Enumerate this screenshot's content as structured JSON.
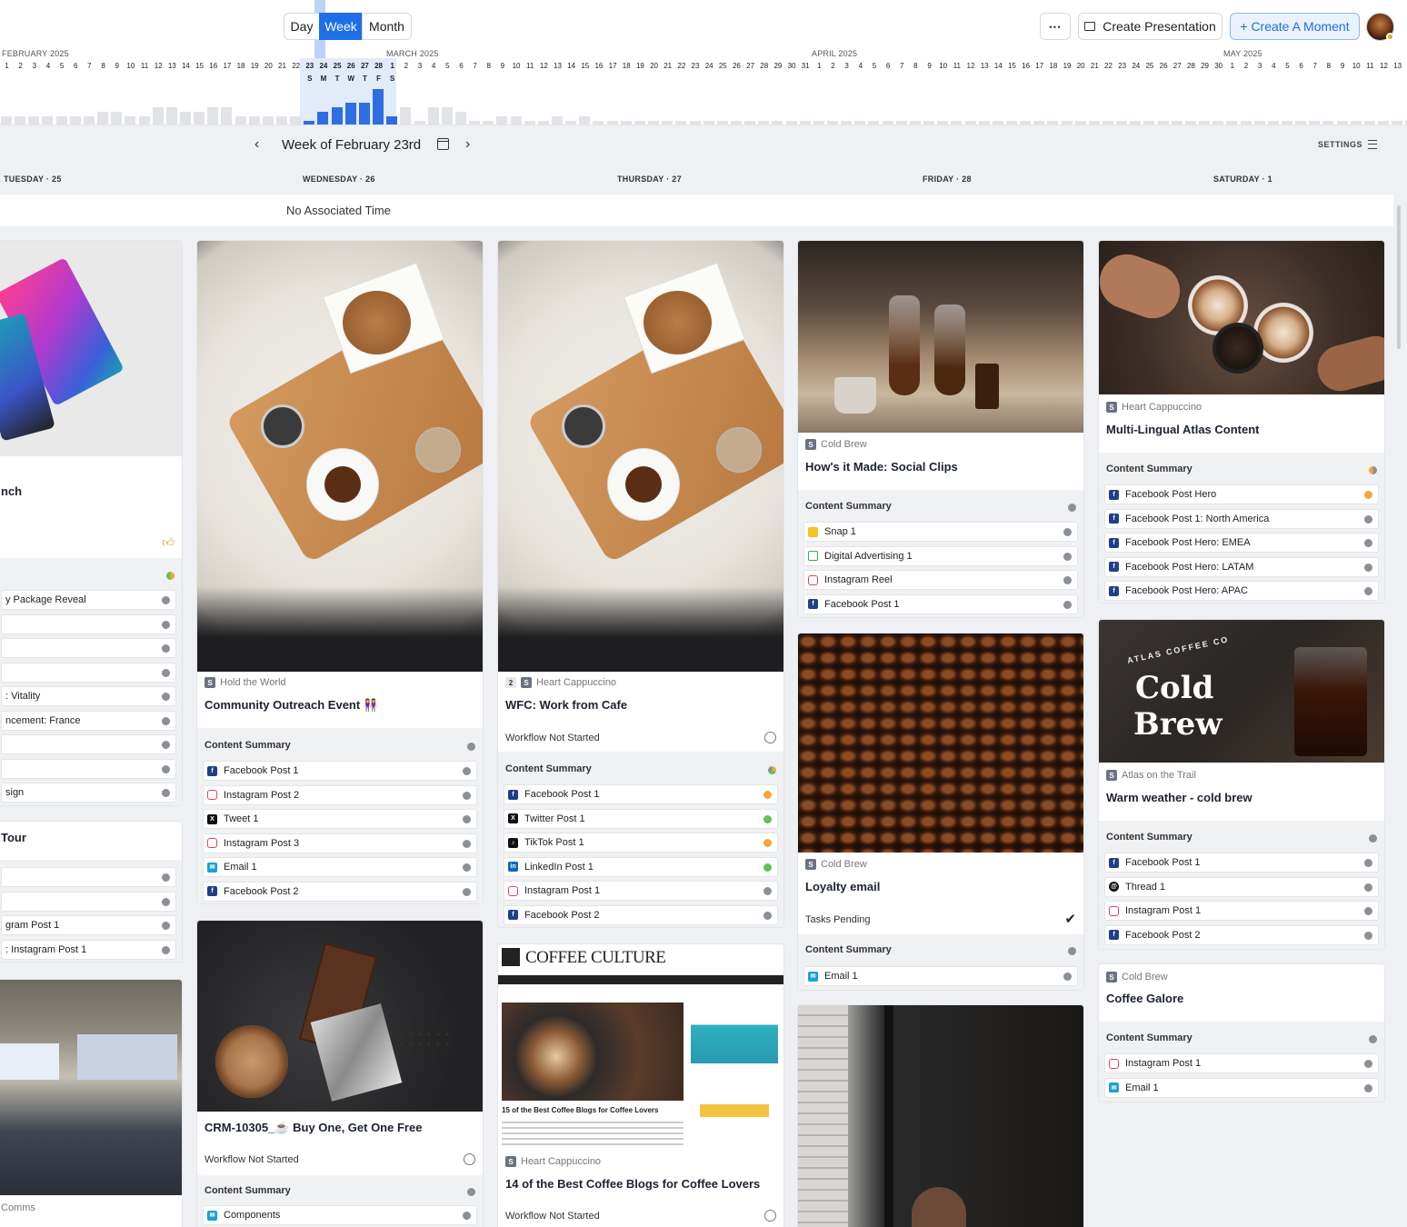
{
  "views": {
    "day": "Day",
    "week": "Week",
    "month": "Month"
  },
  "toolbar": {
    "more": "⋯",
    "present_label": "Create Presentation",
    "moment_label": "+ Create A Moment"
  },
  "icons": {
    "present": "presentation-icon",
    "moment": "plus-icon",
    "calendar": "calendar-icon",
    "settings": "sliders-icon",
    "prev": "chevron-left-icon",
    "next": "chevron-right-icon"
  },
  "timeline": {
    "months": [
      "FEBRUARY 2025",
      "MARCH 2025",
      "APRIL 2025",
      "MAY 2025"
    ],
    "days": [
      "1",
      "2",
      "3",
      "4",
      "5",
      "6",
      "7",
      "8",
      "9",
      "10",
      "11",
      "12",
      "13",
      "14",
      "15",
      "16",
      "17",
      "18",
      "19",
      "20",
      "21",
      "22",
      "23",
      "24",
      "25",
      "26",
      "27",
      "28",
      "1",
      "2",
      "3",
      "4",
      "5",
      "6",
      "7",
      "8",
      "9",
      "10",
      "11",
      "12",
      "13",
      "14",
      "15",
      "16",
      "17",
      "18",
      "19",
      "20",
      "21",
      "22",
      "23",
      "24",
      "25",
      "26",
      "27",
      "28",
      "29",
      "30",
      "31",
      "1",
      "2",
      "3",
      "4",
      "5",
      "6",
      "7",
      "8",
      "9",
      "10",
      "11",
      "12",
      "13",
      "14",
      "15",
      "16",
      "17",
      "18",
      "19",
      "20",
      "21",
      "22",
      "23",
      "24",
      "25",
      "26",
      "27",
      "28",
      "29",
      "30",
      "1",
      "2",
      "3",
      "4",
      "5",
      "6",
      "7",
      "8",
      "9",
      "10",
      "11",
      "12",
      "13",
      "14"
    ],
    "week_letters": [
      "S",
      "M",
      "T",
      "W",
      "T",
      "F",
      "S"
    ],
    "counts": [
      1,
      1,
      1,
      1,
      1,
      1,
      1,
      2,
      2,
      1,
      1,
      3,
      3,
      2,
      2,
      3,
      3,
      1,
      1,
      1,
      1,
      1,
      0,
      2,
      3,
      4,
      4,
      7,
      1,
      3,
      0,
      3,
      3,
      2,
      0,
      0,
      1,
      1,
      0,
      0,
      1,
      0,
      1,
      0,
      0,
      0,
      0,
      0,
      0,
      0,
      0,
      0,
      0,
      0,
      0,
      0,
      0,
      0,
      0,
      0,
      0,
      0,
      0,
      0,
      0,
      0,
      0,
      0,
      0,
      0,
      0,
      0,
      0,
      0,
      0,
      0,
      0,
      0,
      0,
      0,
      0,
      0,
      0,
      0,
      0,
      0,
      0,
      0,
      0,
      0,
      0,
      0,
      0,
      0,
      0,
      0,
      0,
      0,
      0,
      0,
      0,
      0,
      0,
      0
    ]
  },
  "weeknav": {
    "title": "Week of February 23rd",
    "settings": "SETTINGS"
  },
  "day_headers": [
    "TUESDAY · 25",
    "WEDNESDAY · 26",
    "THURSDAY · 27",
    "FRIDAY · 28",
    "SATURDAY · 1"
  ],
  "no_associated_time": "No Associated Time",
  "tuesday": {
    "card1": {
      "title_frag": "nch",
      "items": [
        "y Package Reveal",
        "",
        "",
        "",
        ": Vitality",
        "ncement: France",
        "",
        "",
        "sign"
      ]
    },
    "card2": {
      "title_frag": "Tour",
      "items": [
        "",
        "",
        "gram Post 1",
        ": Instagram Post 1"
      ]
    },
    "card3": {
      "meta_frag": "Comms"
    }
  },
  "wednesday": {
    "card1": {
      "campaign": "Hold the World",
      "title": "Community Outreach Event 👭",
      "summary": "Content Summary",
      "items": [
        {
          "icon": "facebook",
          "label": "Facebook Post 1"
        },
        {
          "icon": "instagram",
          "label": "Instagram Post 2"
        },
        {
          "icon": "x",
          "label": "Tweet 1"
        },
        {
          "icon": "instagram",
          "label": "Instagram Post 3"
        },
        {
          "icon": "email",
          "label": "Email 1"
        },
        {
          "icon": "facebook",
          "label": "Facebook Post 2"
        }
      ]
    },
    "card2": {
      "title": "CRM-10305_☕ Buy One, Get One Free",
      "workflow": "Workflow Not Started",
      "summary": "Content Summary",
      "items": [
        {
          "icon": "email",
          "label": "Components"
        }
      ]
    }
  },
  "thursday": {
    "card1": {
      "count": "2",
      "campaign": "Heart Cappuccino",
      "title": "WFC: Work from Cafe",
      "workflow": "Workflow Not Started",
      "summary": "Content Summary",
      "items": [
        {
          "icon": "facebook",
          "label": "Facebook Post 1",
          "status": "orange"
        },
        {
          "icon": "x",
          "label": "Twitter Post 1",
          "status": "green"
        },
        {
          "icon": "tiktok",
          "label": "TikTok Post 1",
          "status": "orange"
        },
        {
          "icon": "linkedin",
          "label": "LinkedIn Post 1",
          "status": "green"
        },
        {
          "icon": "instagram",
          "label": "Instagram Post 1",
          "status": "gray"
        },
        {
          "icon": "facebook",
          "label": "Facebook Post 2",
          "status": "gray"
        }
      ]
    },
    "card2": {
      "campaign": "Heart Cappuccino",
      "title": "14 of the Best Coffee Blogs for Coffee Lovers",
      "workflow": "Workflow Not Started",
      "masthead": "COFFEE CULTURE",
      "headline": "15 of the Best Coffee Blogs for Coffee Lovers"
    }
  },
  "friday": {
    "card1": {
      "campaign": "Cold Brew",
      "title": "How's it Made: Social Clips",
      "summary": "Content Summary",
      "items": [
        {
          "icon": "snapchat",
          "label": "Snap 1"
        },
        {
          "icon": "digital",
          "label": "Digital Advertising 1"
        },
        {
          "icon": "instagram",
          "label": "Instagram Reel"
        },
        {
          "icon": "facebook",
          "label": "Facebook Post 1"
        }
      ]
    },
    "card2": {
      "campaign": "Cold Brew",
      "title": "Loyalty email",
      "tasks": "Tasks Pending",
      "summary": "Content Summary",
      "items": [
        {
          "icon": "email",
          "label": "Email 1"
        }
      ]
    }
  },
  "saturday": {
    "card1": {
      "campaign": "Heart Cappuccino",
      "title": "Multi-Lingual Atlas Content",
      "summary": "Content Summary",
      "items": [
        {
          "icon": "facebook",
          "label": "Facebook Post Hero",
          "status": "orange"
        },
        {
          "icon": "facebook",
          "label": "Facebook Post 1: North America"
        },
        {
          "icon": "facebook",
          "label": "Facebook Post Hero: EMEA"
        },
        {
          "icon": "facebook",
          "label": "Facebook Post Hero: LATAM"
        },
        {
          "icon": "facebook",
          "label": "Facebook Post Hero: APAC"
        }
      ]
    },
    "card2": {
      "campaign": "Atlas on the Trail",
      "title": "Warm weather - cold brew",
      "summary": "Content Summary",
      "sign_top": "ATLAS COFFEE CO",
      "sign_main1": "Cold",
      "sign_main2": "Brew",
      "items": [
        {
          "icon": "facebook",
          "label": "Facebook Post 1"
        },
        {
          "icon": "threads",
          "label": "Thread 1"
        },
        {
          "icon": "instagram",
          "label": "Instagram Post 1"
        },
        {
          "icon": "facebook",
          "label": "Facebook Post 2"
        }
      ]
    },
    "card3": {
      "campaign": "Cold Brew",
      "title": "Coffee Galore",
      "summary": "Content Summary",
      "items": [
        {
          "icon": "instagram",
          "label": "Instagram Post 1"
        },
        {
          "icon": "email",
          "label": "Email 1"
        }
      ]
    }
  },
  "colors": {
    "accent": "#1d6fe8",
    "status_orange": "#f3a63b",
    "status_green": "#5ec452",
    "status_gray": "#8a8f98"
  }
}
